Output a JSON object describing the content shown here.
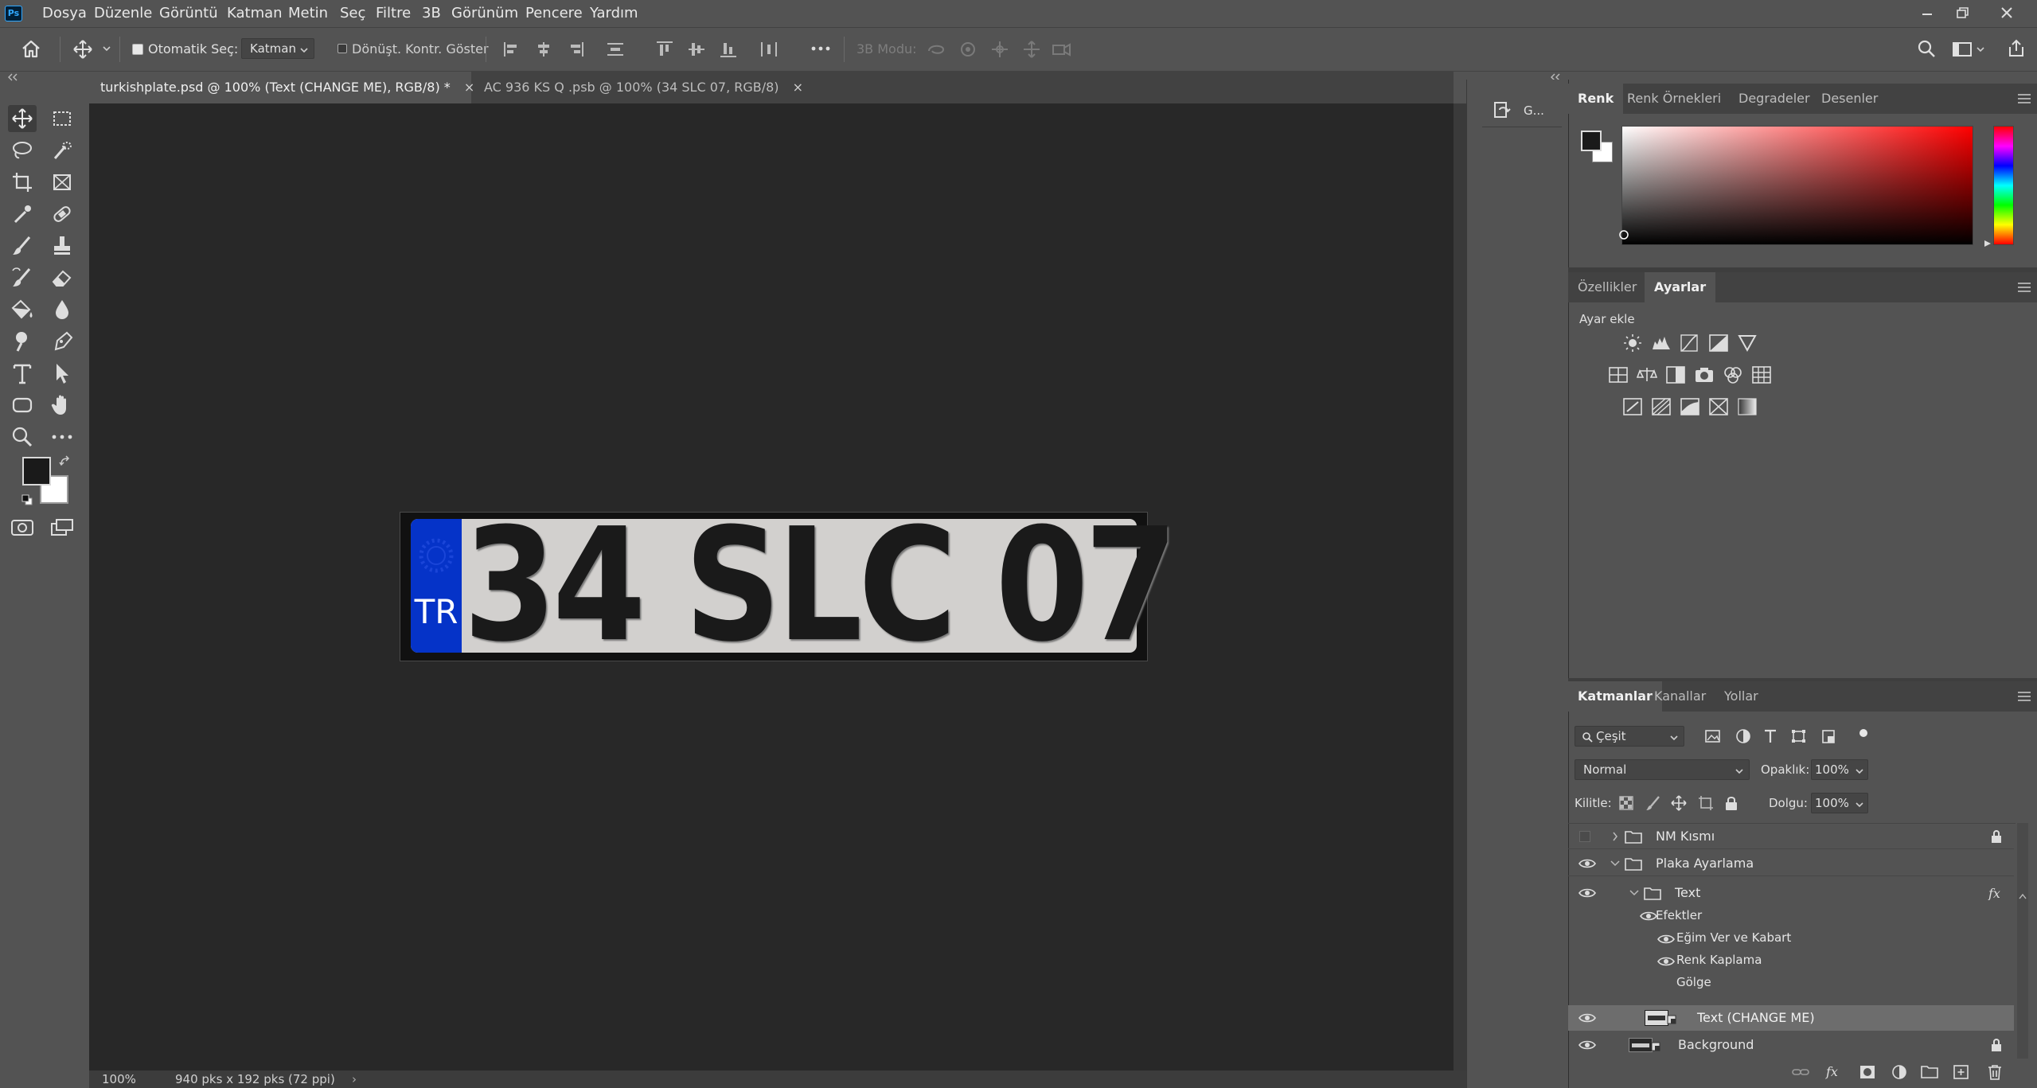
{
  "app": {
    "logo": "Ps"
  },
  "menu": [
    "Dosya",
    "Düzenle",
    "Görüntü",
    "Katman",
    "Metin",
    "Seç",
    "Filtre",
    "3B",
    "Görünüm",
    "Pencere",
    "Yardım"
  ],
  "options": {
    "auto_select_label": "Otomatik Seç:",
    "auto_select_value": "Katman",
    "transform_label": "Dönüşt. Kontr. Göster",
    "mode3d_label": "3B Modu:"
  },
  "tabs": [
    {
      "label": "turkishplate.psd @ 100% (Text (CHANGE ME), RGB/8) *",
      "close": "×"
    },
    {
      "label": "AC 936 KS Q .psb @ 100% (34 SLC 07, RGB/8)",
      "close": "×"
    }
  ],
  "plate": {
    "country": "TR",
    "number": "34 SLC 07"
  },
  "status": {
    "zoom": "100%",
    "info": "940 pks x 192 pks (72 ppi)"
  },
  "mid_panel": {
    "label": "G..."
  },
  "color_panel": {
    "tabs": [
      "Renk",
      "Renk Örnekleri",
      "Degradeler",
      "Desenler"
    ],
    "fg": "#1a1a1a",
    "bg": "#ffffff",
    "hue": "#ff0000"
  },
  "props_panel": {
    "tabs": [
      "Özellikler",
      "Ayarlar"
    ],
    "heading": "Ayar ekle"
  },
  "layers_panel": {
    "tabs": [
      "Katmanlar",
      "Kanallar",
      "Yollar"
    ],
    "filter_label": "Çeşit",
    "blend_mode": "Normal",
    "opacity_label": "Opaklık:",
    "opacity_value": "100%",
    "lock_label": "Kilitle:",
    "fill_label": "Dolgu:",
    "fill_value": "100%",
    "layers": [
      {
        "name": "NM Kısmı"
      },
      {
        "name": "Plaka Ayarlama"
      },
      {
        "name": "Text"
      },
      {
        "name": "Efektler"
      },
      {
        "name": "Eğim Ver ve Kabart"
      },
      {
        "name": "Renk Kaplama"
      },
      {
        "name": "Gölge"
      },
      {
        "name": "Text (CHANGE ME)"
      },
      {
        "name": "Background"
      }
    ]
  }
}
